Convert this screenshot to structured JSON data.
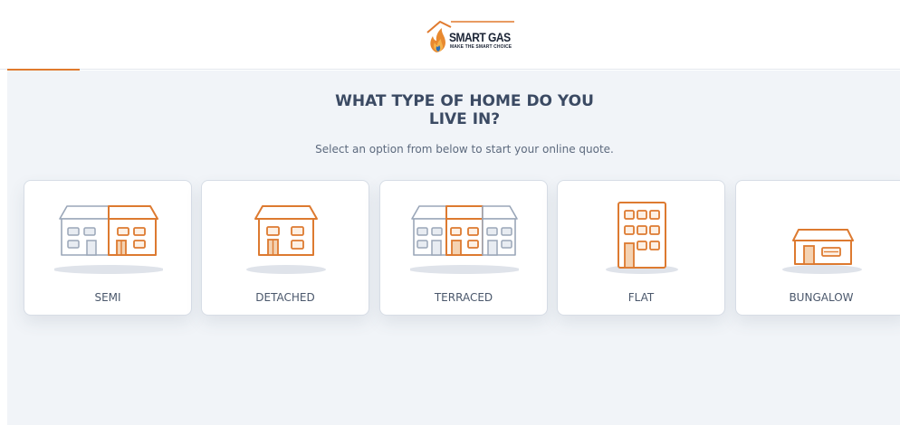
{
  "brand": {
    "name": "SMART GAS",
    "tagline": "MAKE THE SMART CHOICE",
    "accent_color": "#e07a2e",
    "flame_icon": "flame-house-icon"
  },
  "progress": {
    "value_percent": 8
  },
  "page": {
    "title_line1": "WHAT TYPE OF HOME DO YOU",
    "title_line2": "LIVE IN?",
    "subtitle": "Select an option from below to start your online quote."
  },
  "options": [
    {
      "label": "SEMI",
      "icon": "semi-detached-house-icon"
    },
    {
      "label": "DETACHED",
      "icon": "detached-house-icon"
    },
    {
      "label": "TERRACED",
      "icon": "terraced-house-icon"
    },
    {
      "label": "FLAT",
      "icon": "flat-building-icon"
    },
    {
      "label": "BUNGALOW",
      "icon": "bungalow-icon"
    }
  ]
}
